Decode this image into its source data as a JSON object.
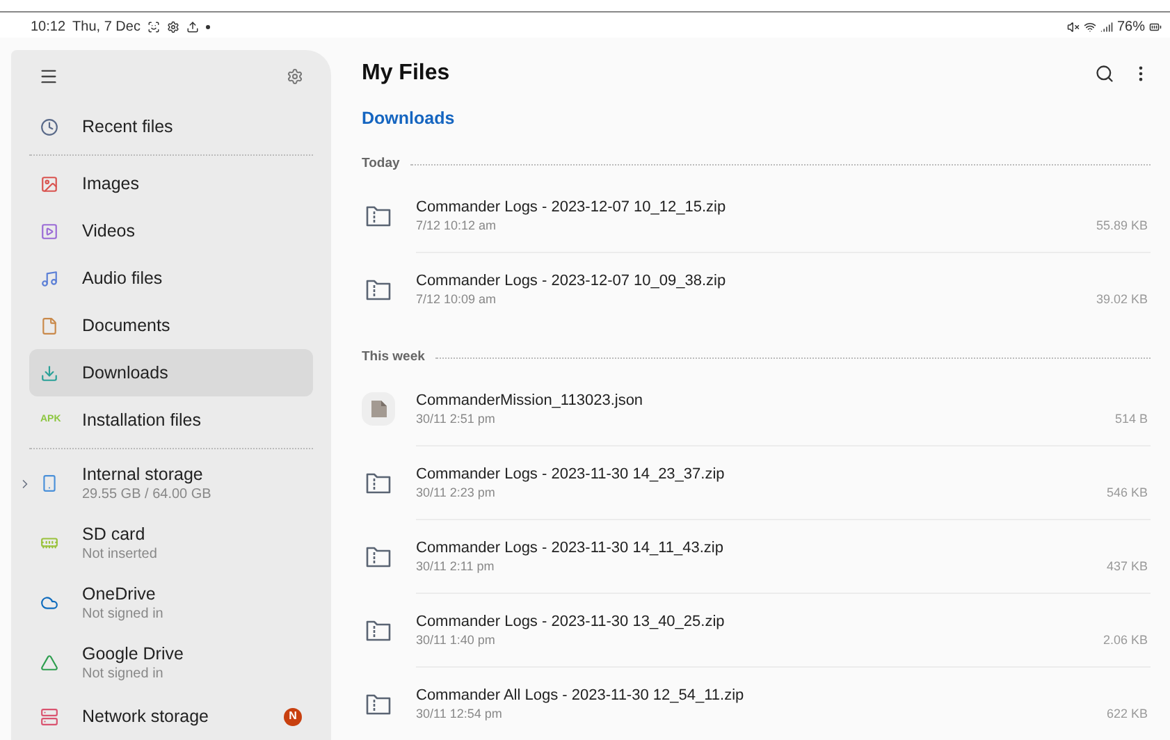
{
  "status_bar": {
    "time": "10:12",
    "date": "Thu, 7 Dec",
    "battery": "76%"
  },
  "sidebar": {
    "sections": [
      [
        {
          "label": "Recent files",
          "selected": false
        }
      ],
      [
        {
          "label": "Images",
          "selected": false
        },
        {
          "label": "Videos",
          "selected": false
        },
        {
          "label": "Audio files",
          "selected": false
        },
        {
          "label": "Documents",
          "selected": false
        },
        {
          "label": "Downloads",
          "selected": true
        },
        {
          "label": "Installation files",
          "icon_text": "APK",
          "selected": false
        }
      ],
      [
        {
          "label": "Internal storage",
          "sublabel": "29.55 GB / 64.00 GB",
          "expanded": false,
          "selected": false
        },
        {
          "label": "SD card",
          "sublabel": "Not inserted",
          "selected": false
        },
        {
          "label": "OneDrive",
          "sublabel": "Not signed in",
          "selected": false
        },
        {
          "label": "Google Drive",
          "sublabel": "Not signed in",
          "selected": false
        },
        {
          "label": "Network storage",
          "badge": "N",
          "selected": false
        }
      ]
    ]
  },
  "main": {
    "title": "My Files",
    "breadcrumb": "Downloads",
    "groups": [
      {
        "label": "Today",
        "files": [
          {
            "kind": "zip",
            "name": "Commander Logs - 2023-12-07 10_12_15.zip",
            "date": "7/12 10:12 am",
            "size": "55.89 KB"
          },
          {
            "kind": "zip",
            "name": "Commander Logs - 2023-12-07 10_09_38.zip",
            "date": "7/12 10:09 am",
            "size": "39.02 KB"
          }
        ]
      },
      {
        "label": "This week",
        "files": [
          {
            "kind": "json",
            "name": "CommanderMission_113023.json",
            "date": "30/11 2:51 pm",
            "size": "514 B"
          },
          {
            "kind": "zip",
            "name": "Commander Logs - 2023-11-30 14_23_37.zip",
            "date": "30/11 2:23 pm",
            "size": "546 KB"
          },
          {
            "kind": "zip",
            "name": "Commander Logs - 2023-11-30 14_11_43.zip",
            "date": "30/11 2:11 pm",
            "size": "437 KB"
          },
          {
            "kind": "zip",
            "name": "Commander Logs - 2023-11-30 13_40_25.zip",
            "date": "30/11 1:40 pm",
            "size": "2.06 KB"
          },
          {
            "kind": "zip",
            "name": "Commander All Logs - 2023-11-30 12_54_11.zip",
            "date": "30/11 12:54 pm",
            "size": "622 KB"
          }
        ]
      }
    ]
  }
}
